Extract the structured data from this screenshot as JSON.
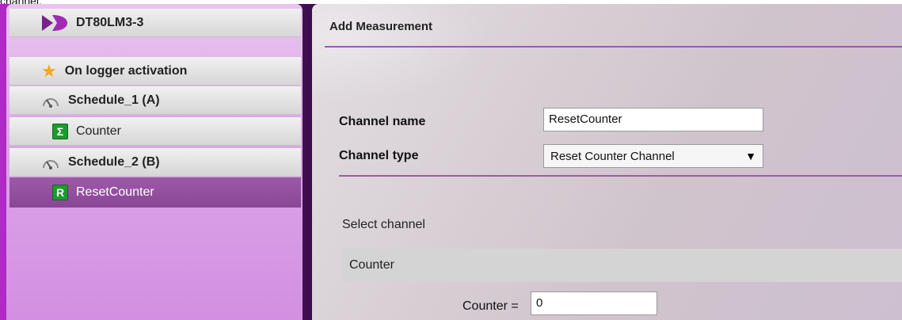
{
  "top_strip": {
    "text": "channel."
  },
  "tree": {
    "logger": {
      "label": "DT80LM3-3",
      "icon": "dataTaker-logo-icon"
    },
    "items": [
      {
        "label": "On logger activation",
        "icon": "star-icon"
      },
      {
        "label": "Schedule_1 (A)",
        "icon": "schedule-gauge-icon"
      },
      {
        "label": "Counter",
        "icon": "sigma-icon",
        "icon_glyph": "Σ"
      },
      {
        "label": "Schedule_2 (B)",
        "icon": "schedule-gauge-icon"
      },
      {
        "label": "ResetCounter",
        "icon": "reset-icon",
        "icon_glyph": "R",
        "selected": true
      }
    ]
  },
  "form": {
    "title": "Add Measurement",
    "channel_name_label": "Channel name",
    "channel_name_value": "ResetCounter",
    "channel_type_label": "Channel type",
    "channel_type_value": "Reset Counter Channel",
    "select_channel_label": "Select channel",
    "selected_channel": "Counter",
    "counter_label": "Counter =",
    "counter_value": "0"
  },
  "colors": {
    "accent_purple": "#9c5ba8",
    "selected_row": "#8a4696",
    "channel_icon_green": "#1c9a2e",
    "star": "#f3a81b"
  }
}
